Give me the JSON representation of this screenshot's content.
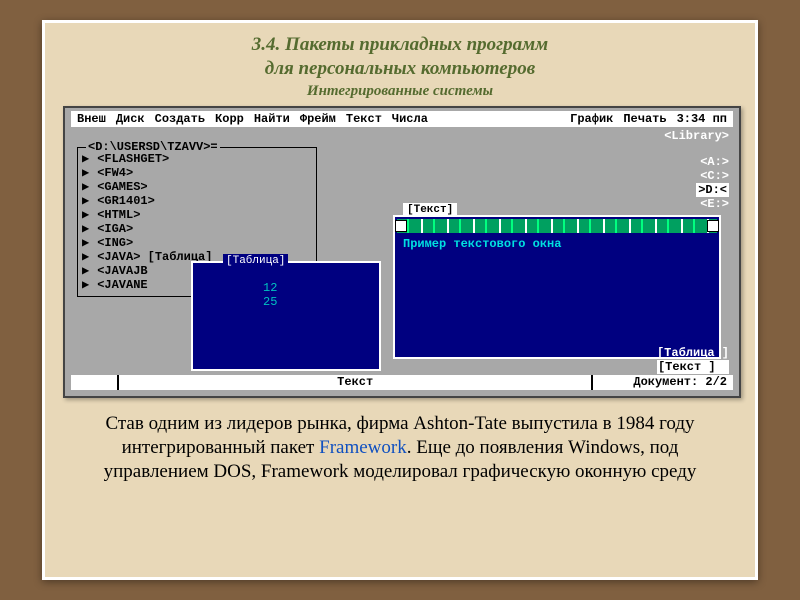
{
  "slide": {
    "title_line1": "3.4. Пакеты прикладных программ",
    "title_line2": "для персональных компьютеров",
    "subtitle": "Интегрированные системы"
  },
  "dos": {
    "menu": [
      "Внеш",
      "Диск",
      "Создать",
      "Корр",
      "Найти",
      "Фрейм",
      "Текст",
      "Числа",
      "График",
      "Печать"
    ],
    "clock": "3:34 пп",
    "library_label": "<Library>",
    "drives": [
      "<A:>",
      "<C:>",
      ">D:<",
      "<E:>"
    ],
    "active_drive_index": 2,
    "file_window": {
      "path": "<D:\\USERSD\\TZAVV>=",
      "items": [
        "<FLASHGET>",
        "<FW4>",
        "<GAMES>",
        "<GR1401>",
        "<HTML>",
        "<IGA>",
        "<ING>",
        "<JAVA> [Таблица]",
        "<JAVAJB",
        "<JAVANE"
      ]
    },
    "table_window": {
      "title": "[Таблица]",
      "values": [
        "12",
        "25"
      ]
    },
    "text_window": {
      "tab": "[Текст]",
      "content": "Пример текстового окна"
    },
    "bottom_labels": [
      "[Таблица ]",
      "[Текст   ]"
    ],
    "statusbar": {
      "mode": "Текст",
      "doc": "Документ: 2/2"
    }
  },
  "caption": {
    "t1": "Став одним из лидеров рынка, фирма Ashton-Tate выпустила в  1984 году  интегрированный пакет ",
    "link": "Framework",
    "t2": ". Еще до появления Windows, под управлением DOS,  Framework моделировал графическую оконную среду"
  }
}
